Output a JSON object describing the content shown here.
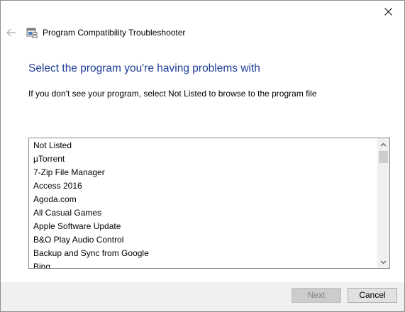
{
  "window": {
    "title": "Program Compatibility Troubleshooter",
    "title_icon": "troubleshooter-icon",
    "close_icon": "close-icon",
    "back_icon": "back-arrow-icon"
  },
  "main": {
    "heading": "Select the program you're having problems with",
    "instruction": "If you don't see your program, select Not Listed to browse to the program file",
    "programs": [
      "Not Listed",
      "µTorrent",
      "7-Zip File Manager",
      "Access 2016",
      "Agoda.com",
      "All Casual Games",
      "Apple Software Update",
      "B&O Play Audio Control",
      "Backup and Sync from Google",
      "Bing"
    ]
  },
  "footer": {
    "next_label": "Next",
    "cancel_label": "Cancel"
  },
  "colors": {
    "heading": "#1e3c96",
    "footer_bg": "#f0f0f0",
    "disabled_text": "#838383"
  }
}
